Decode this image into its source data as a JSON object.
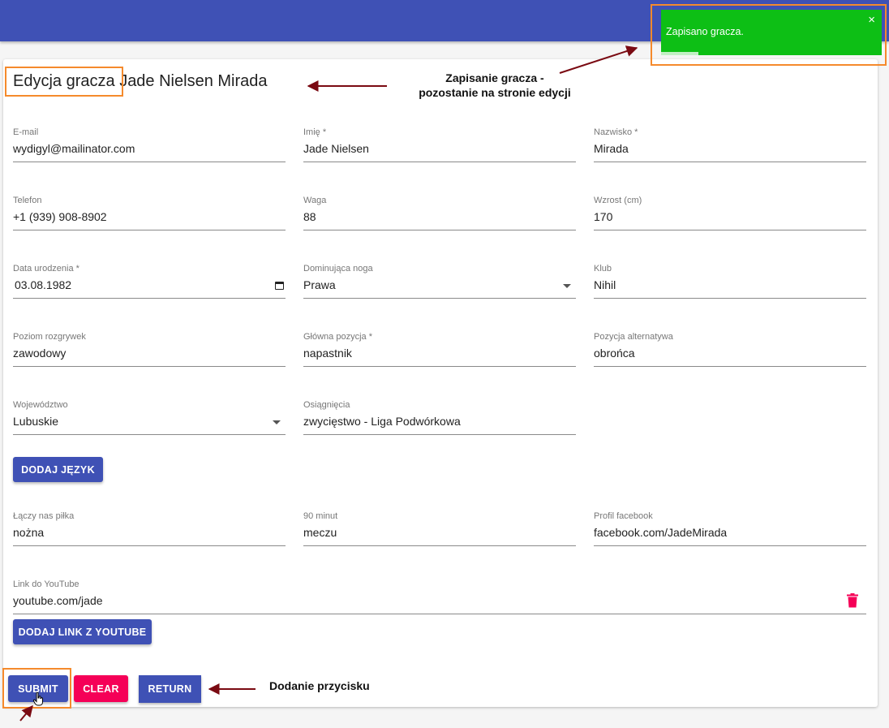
{
  "toast": {
    "message": "Zapisano gracza.",
    "close_label": "×",
    "progress_fraction": 0.17,
    "color": "#0dbf15"
  },
  "page": {
    "title_prefix": "Edycja gracza",
    "title_name": "Jade Nielsen Mirada"
  },
  "fields": {
    "email": {
      "label": "E-mail",
      "value": "wydigyl@mailinator.com"
    },
    "first_name": {
      "label": "Imię *",
      "value": "Jade Nielsen"
    },
    "last_name": {
      "label": "Nazwisko *",
      "value": "Mirada"
    },
    "phone": {
      "label": "Telefon",
      "value": "+1 (939) 908-8902"
    },
    "weight": {
      "label": "Waga",
      "value": "88"
    },
    "height": {
      "label": "Wzrost (cm)",
      "value": "170"
    },
    "birth_date": {
      "label": "Data urodzenia *",
      "value": "03.08.1982"
    },
    "dominant_foot": {
      "label": "Dominująca noga",
      "value": "Prawa"
    },
    "club": {
      "label": "Klub",
      "value": "Nihil"
    },
    "level": {
      "label": "Poziom rozgrywek",
      "value": "zawodowy"
    },
    "main_position": {
      "label": "Główna pozycja *",
      "value": "napastnik"
    },
    "alt_position": {
      "label": "Pozycja alternatywa",
      "value": "obrońca"
    },
    "voivodeship": {
      "label": "Województwo",
      "value": "Lubuskie"
    },
    "achievements": {
      "label": "Osiągnięcia",
      "value": "zwycięstwo - Liga Podwórkowa"
    },
    "laczy": {
      "label": "Łączy nas piłka",
      "value": "nożna"
    },
    "minut90": {
      "label": "90 minut",
      "value": "meczu"
    },
    "facebook": {
      "label": "Profil facebook",
      "value": "facebook.com/JadeMirada"
    },
    "youtube": {
      "label": "Link do YouTube",
      "value": "youtube.com/jade"
    }
  },
  "buttons": {
    "add_language": "DODAJ JĘZYK",
    "add_youtube": "DODAJ LINK Z YOUTUBE",
    "submit": "SUBMIT",
    "clear": "CLEAR",
    "return": "RETURN"
  },
  "annotations": {
    "save_note_line1": "Zapisanie gracza -",
    "save_note_line2": "pozostanie na stronie edycji",
    "button_note": "Dodanie przycisku"
  },
  "colors": {
    "primary": "#3f51b5",
    "secondary": "#f50057",
    "highlight": "#f58a2c",
    "arrow": "#7a0a12"
  },
  "icons": {
    "delete": "trash-icon",
    "date": "calendar-icon",
    "select": "dropdown-caret-icon",
    "close": "close-icon"
  }
}
